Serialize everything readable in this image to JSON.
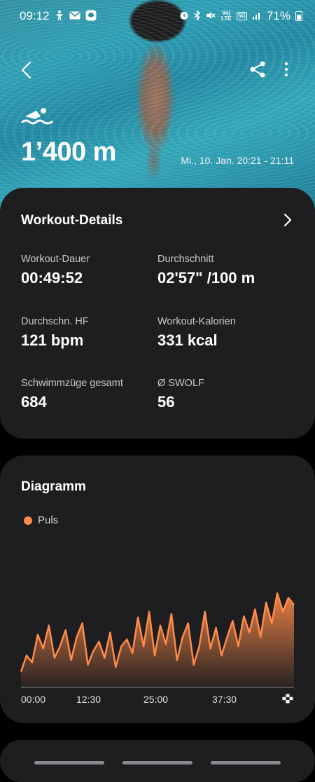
{
  "status_bar": {
    "time": "09:12",
    "left_icons": [
      "accessibility-icon",
      "mail-icon",
      "messenger-icon"
    ],
    "right_icons": [
      "alarm-icon",
      "bluetooth-icon",
      "mute-icon",
      "volte-icon",
      "5g-icon",
      "signal-icon"
    ],
    "volte_text": "Vo) LTE",
    "network": "5G",
    "battery": "71%"
  },
  "hero": {
    "distance": "1’400 m",
    "date_time": "Mi., 10. Jan. 20:21 - 21:11",
    "icons": [
      "back-icon",
      "share-icon",
      "more-icon",
      "swimming-icon"
    ]
  },
  "details": {
    "title": "Workout-Details",
    "stats": [
      {
        "label": "Workout-Dauer",
        "value": "00:49:52"
      },
      {
        "label": "Durchschnitt",
        "value": "02'57\" /100 m"
      },
      {
        "label": "Durchschn. HF",
        "value": "121 bpm"
      },
      {
        "label": "Workout-Kalorien",
        "value": "331 kcal"
      },
      {
        "label": "Schwimmzüge gesamt",
        "value": "684"
      },
      {
        "label": "Ø SWOLF",
        "value": "56"
      }
    ]
  },
  "chart": {
    "title": "Diagramm",
    "legend": "Puls",
    "accent": "#ff8b4a",
    "xticks": [
      "00:00",
      "12:30",
      "25:00",
      "37:30"
    ],
    "end_icon": "finish-flag-icon"
  },
  "chart_data": {
    "type": "area",
    "x_minutes": [
      0,
      1,
      2,
      3,
      4,
      5,
      6,
      7,
      8,
      9,
      10,
      11,
      12,
      13,
      14,
      15,
      16,
      17,
      18,
      19,
      20,
      21,
      22,
      23,
      24,
      25,
      26,
      27,
      28,
      29,
      30,
      31,
      32,
      33,
      34,
      35,
      36,
      37,
      38,
      39,
      40,
      41,
      42,
      43,
      44,
      45,
      46,
      47,
      48,
      49
    ],
    "xticks": [
      "00:00",
      "12:30",
      "25:00",
      "37:30"
    ],
    "series": [
      {
        "name": "Puls",
        "color": "#ff8b4a",
        "values": [
          98,
          112,
          106,
          130,
          118,
          138,
          110,
          120,
          134,
          108,
          128,
          140,
          104,
          116,
          124,
          110,
          132,
          102,
          120,
          126,
          114,
          145,
          120,
          150,
          112,
          138,
          122,
          148,
          108,
          128,
          140,
          104,
          120,
          150,
          118,
          136,
          112,
          128,
          142,
          120,
          146,
          132,
          152,
          128,
          158,
          140,
          166,
          150,
          162,
          156
        ]
      }
    ]
  },
  "colors": {
    "card_bg": "#1e1e20",
    "page_bg": "#000000",
    "accent": "#ff8b4a"
  }
}
